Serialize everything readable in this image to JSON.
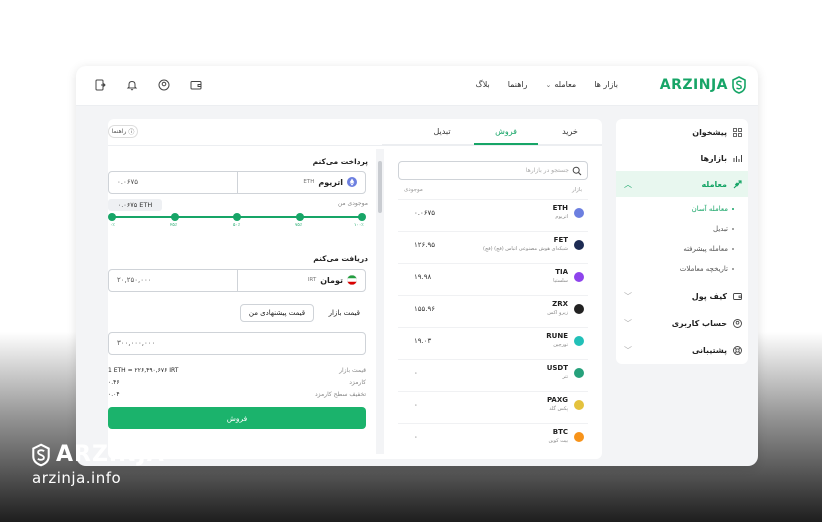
{
  "brand": {
    "name": "ARZINJA",
    "url": "arzinja.info"
  },
  "colors": {
    "accent": "#17a567",
    "accent_button": "#1bb36c"
  },
  "topbar": {
    "logo": "ARZINJA",
    "nav": {
      "markets": "بازار ها",
      "trade": "معامله",
      "guide": "راهنما",
      "blog": "بلاگ"
    },
    "icons": [
      "wallet-icon",
      "user-icon",
      "bell-icon",
      "logout-icon"
    ]
  },
  "sidebar": {
    "items": [
      {
        "label": "پیشخوان",
        "icon": "dashboard-icon"
      },
      {
        "label": "بازارها",
        "icon": "chart-icon"
      },
      {
        "label": "معامله",
        "icon": "trade-icon"
      },
      {
        "label": "کیف پول",
        "icon": "wallet-icon"
      },
      {
        "label": "حساب کاربری",
        "icon": "user-icon"
      },
      {
        "label": "پشتیبانی",
        "icon": "support-icon"
      }
    ],
    "sub_items": [
      "معامله آسان",
      "تبدیل",
      "معامله پیشرفته",
      "تاریخچه معاملات"
    ]
  },
  "trade": {
    "tabs": [
      "خرید",
      "فروش",
      "تبدیل"
    ],
    "guide": "راهنما",
    "pay_label": "پرداخت می‌کنم",
    "pay_amount": "۰.۰۶۷۵",
    "pay_currency": "اتریوم",
    "pay_symbol": "ETH",
    "balance_label": "موجودی من",
    "balance_value": "۰.۰۶۷۵ ETH",
    "slider_percent": 100,
    "ticks": [
      "۰٪",
      "۲۵٪",
      "۵۰٪",
      "۷۵٪",
      "۱۰۰٪"
    ],
    "receive_label": "دریافت می‌کنم",
    "receive_amount": "۲۰,۲۵۰,۰۰۰",
    "receive_currency": "تومان",
    "receive_symbol": "IRT",
    "market_price_btn": "قیمت بازار",
    "suggested_price_btn": "قیمت پیشنهادی من",
    "price_input": "۳۰۰,۰۰۰,۰۰۰",
    "info": [
      {
        "key": "قیمت بازار",
        "value": "1 ETH = ۲۲۶,۴۹۰,۶۷۶ IRT"
      },
      {
        "key": "کارمزد",
        "value": "۰.۴۶"
      },
      {
        "key": "تخفیف سطح کارمزد",
        "value": "۰.۰۴"
      }
    ],
    "submit": "فروش"
  },
  "market": {
    "search_placeholder": "جستجو در بازارها",
    "col_market": "بازار",
    "col_balance": "موجودی",
    "rows": [
      {
        "symbol": "ETH",
        "name": "اتریوم",
        "amount": "۰.۰۶۷۵",
        "color": "#6c7fe0"
      },
      {
        "symbol": "FET",
        "name": "(فچ) شبکه‌ای هوش مصنوعی اتباس (فچ)",
        "amount": "۱۲۶.۹۵",
        "color": "#1d2b53"
      },
      {
        "symbol": "TIA",
        "name": "سلستیا",
        "amount": "۱۹.۹۸",
        "color": "#8e44ec"
      },
      {
        "symbol": "ZRX",
        "name": "زیرو اکس",
        "amount": "۱۵۵.۹۶",
        "color": "#222222"
      },
      {
        "symbol": "RUNE",
        "name": "تورچین",
        "amount": "۱۹.۰۳",
        "color": "#22c0b8"
      },
      {
        "symbol": "USDT",
        "name": "تتر",
        "amount": "۰",
        "color": "#26a17b"
      },
      {
        "symbol": "PAXG",
        "name": "پکس گلد",
        "amount": "۰",
        "color": "#e4c23d"
      },
      {
        "symbol": "BTC",
        "name": "بیت کوین",
        "amount": "۰",
        "color": "#f7931a"
      }
    ]
  }
}
